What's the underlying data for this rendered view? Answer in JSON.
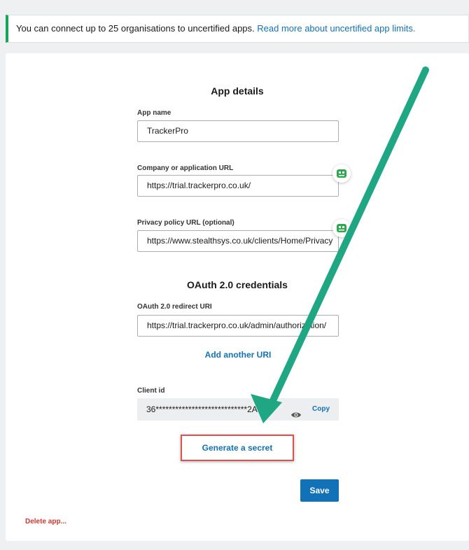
{
  "banner": {
    "text": "You can connect up to 25 organisations to uncertified apps.",
    "link": "Read more about uncertified app limits."
  },
  "app_details": {
    "title": "App details",
    "app_name": {
      "label": "App name",
      "value": "TrackerPro"
    },
    "company_url": {
      "label": "Company or application URL",
      "value": "https://trial.trackerpro.co.uk/"
    },
    "privacy_url": {
      "label": "Privacy policy URL (optional)",
      "value": "https://www.stealthsys.co.uk/clients/Home/Privacy"
    }
  },
  "oauth": {
    "title": "OAuth 2.0 credentials",
    "redirect_uri": {
      "label": "OAuth 2.0 redirect URI",
      "value": "https://trial.trackerpro.co.uk/admin/authorization/"
    },
    "add_uri": "Add another URI",
    "client_id": {
      "label": "Client id",
      "value": "36****************************2A",
      "copy": "Copy"
    },
    "generate_secret": "Generate a secret"
  },
  "actions": {
    "save": "Save",
    "delete": "Delete app..."
  },
  "colors": {
    "accent": "#1172b8",
    "banner_border": "#1aa35a",
    "annotation_arrow": "#1ea782",
    "annotation_box": "#e0514d",
    "danger": "#d23730"
  },
  "icons": [
    "password-manager-icon",
    "eye-icon",
    "annotation-arrow"
  ]
}
